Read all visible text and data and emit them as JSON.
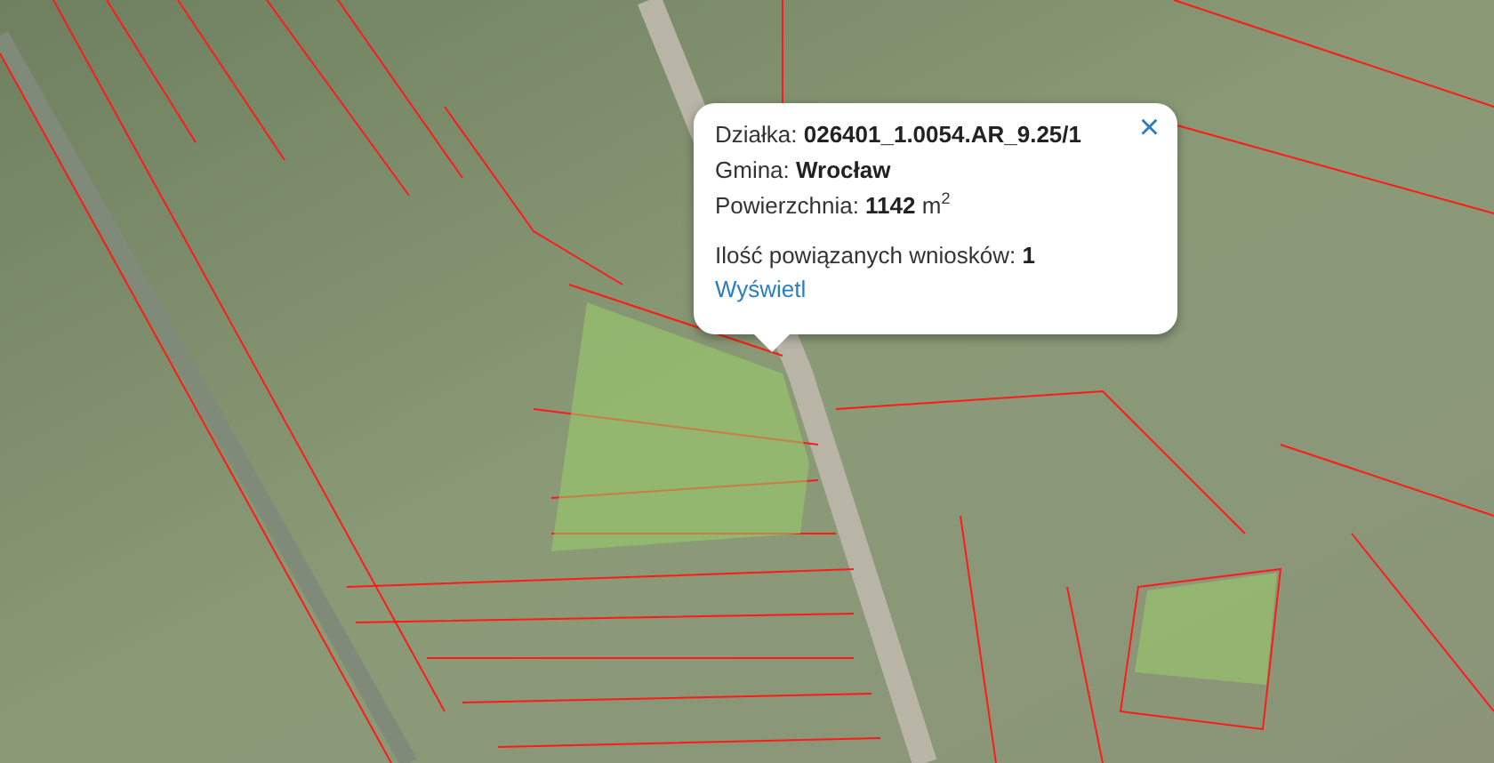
{
  "popup": {
    "close": "×",
    "lines": [
      "Działka: **026401_1.0054.AR_9.25/1**",
      "Gmina: **Wrocław**",
      "Powierzchnia: **1142** m$^{2}$"
    ],
    "count_line": "Ilość powiązanych wniosków: **1**",
    "link": "Wyświetl"
  }
}
